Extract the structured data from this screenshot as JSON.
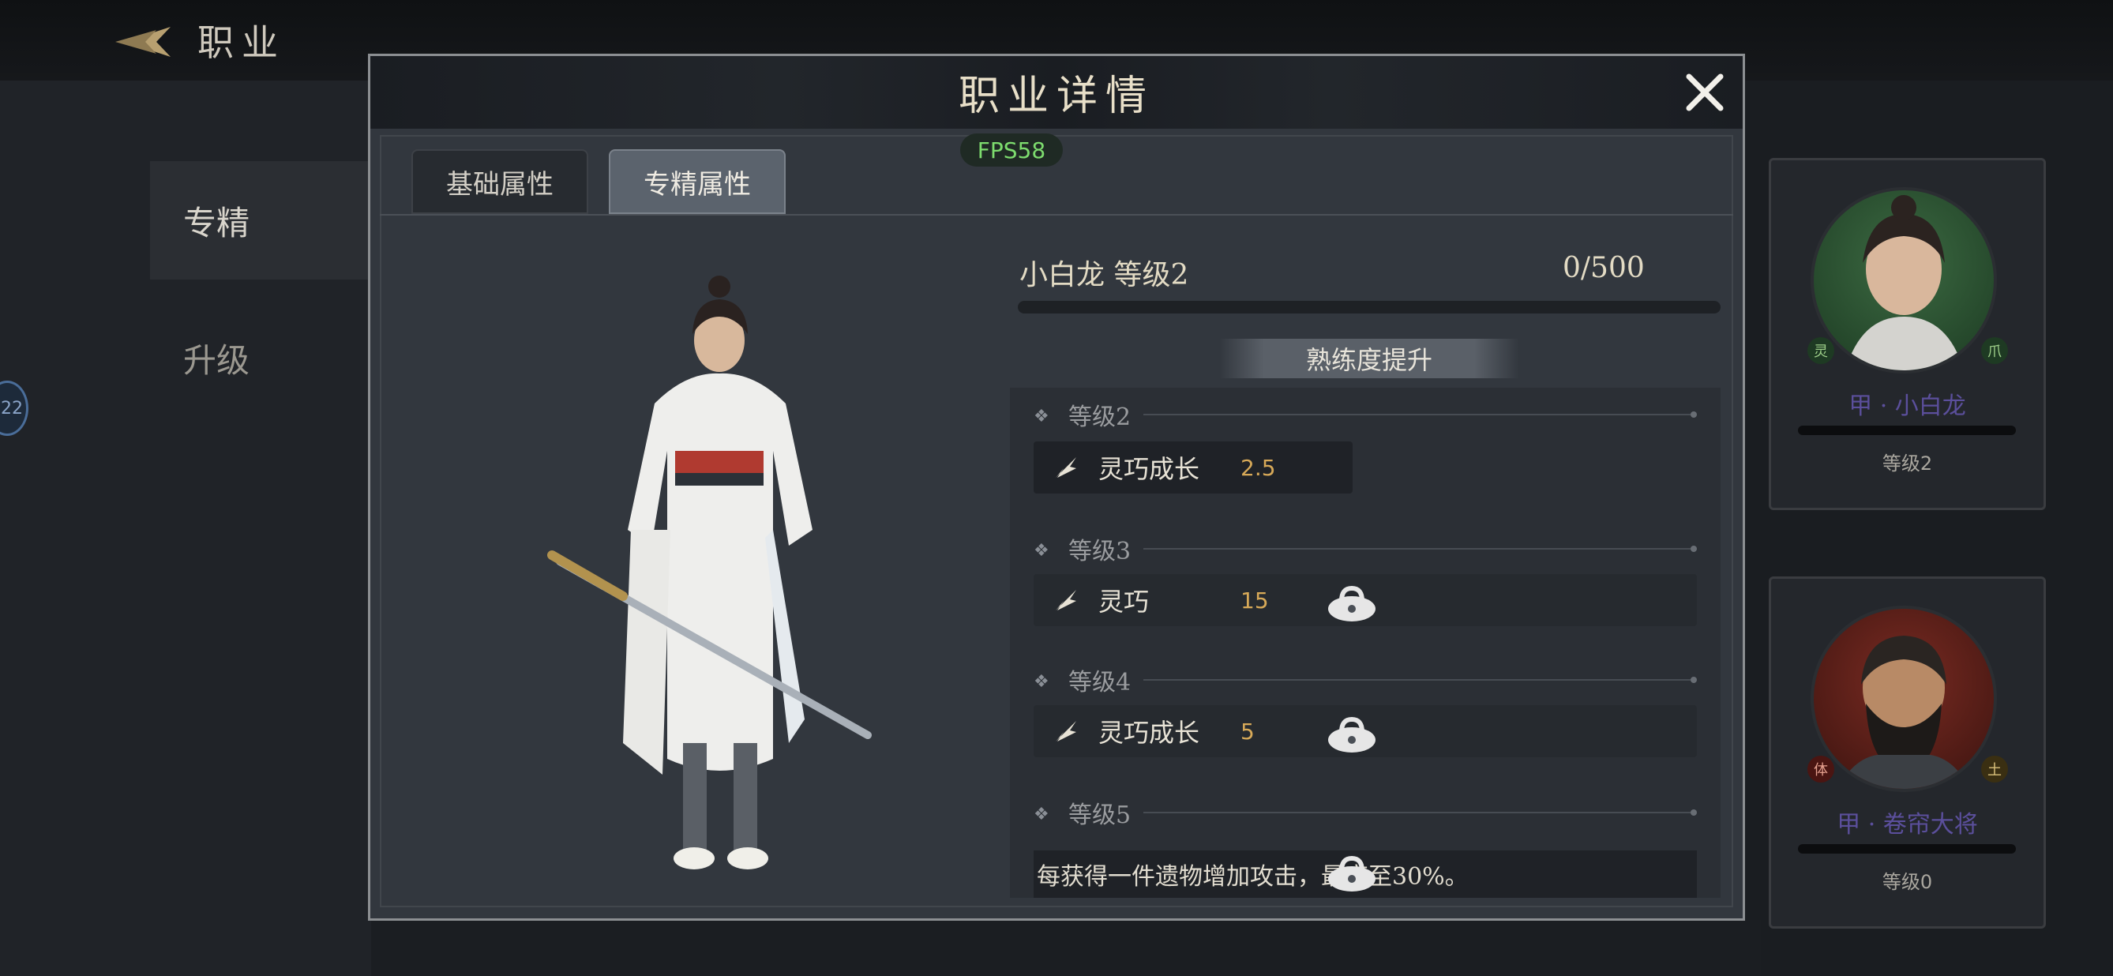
{
  "page": {
    "title": "职业"
  },
  "nav": {
    "items": [
      {
        "label": "专精"
      },
      {
        "label": "升级"
      }
    ],
    "level_badge": "22"
  },
  "cards": [
    {
      "name": "甲 · 小白龙",
      "level": "等级2",
      "badge_left": "灵",
      "badge_right": "爪"
    },
    {
      "name": "甲 · 卷帘大将",
      "level": "等级0",
      "badge_left": "体",
      "badge_right": "土"
    }
  ],
  "modal": {
    "title": "职业详情",
    "fps": "FPS58",
    "tabs": [
      {
        "label": "基础属性"
      },
      {
        "label": "专精属性"
      }
    ],
    "character": {
      "name": "小白龙  等级2",
      "exp_text": "0/500",
      "exp_progress": 0
    },
    "upgrade_label": "熟练度提升",
    "levels": [
      {
        "label": "等级2",
        "attr_name": "灵巧成长",
        "attr_value": "2.5",
        "locked": false
      },
      {
        "label": "等级3",
        "attr_name": "灵巧",
        "attr_value": "15",
        "locked": true
      },
      {
        "label": "等级4",
        "attr_name": "灵巧成长",
        "attr_value": "5",
        "locked": true
      },
      {
        "label": "等级5",
        "desc": "每获得一件遗物增加攻击，最高至30%。",
        "locked": true
      }
    ]
  },
  "colors": {
    "accent_gold": "#d7a958",
    "fps_green": "#7ddc6e",
    "card_name_purple": "#5b4f9c"
  }
}
